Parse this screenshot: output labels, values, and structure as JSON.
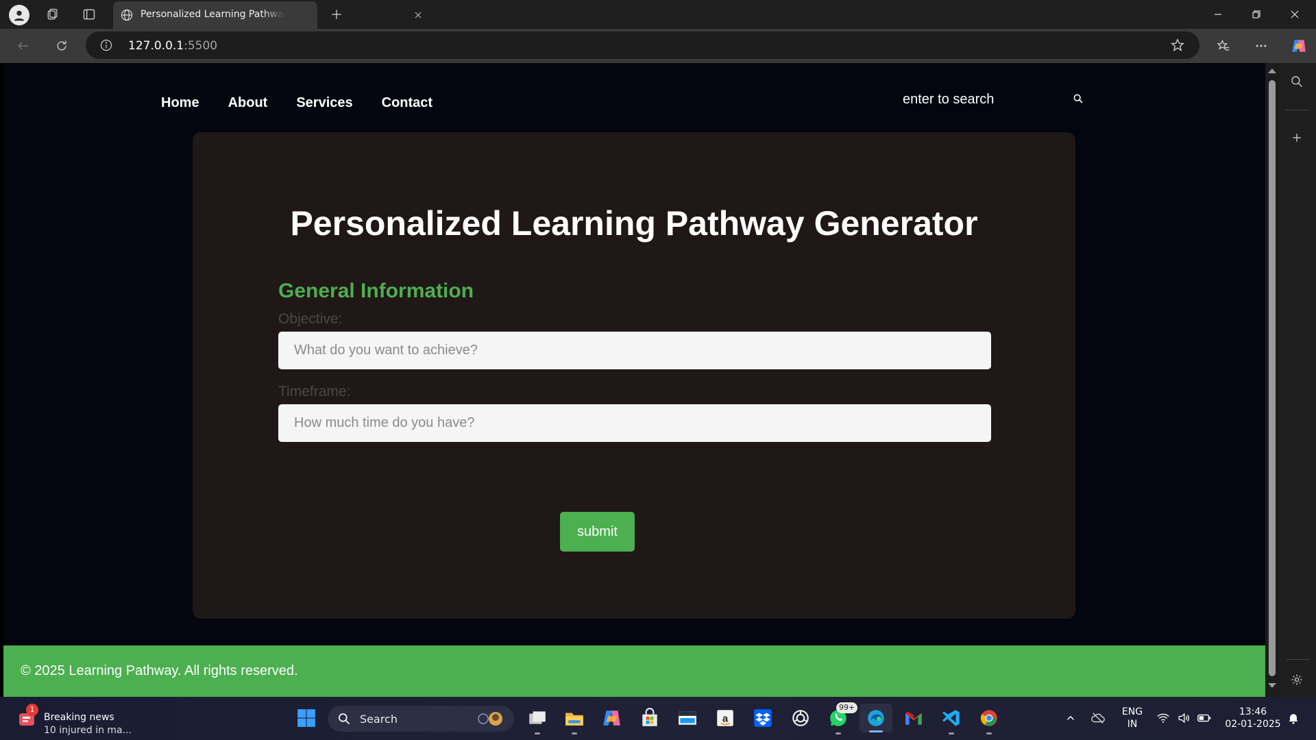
{
  "browser": {
    "tab_title": "Personalized Learning Pathway Generator",
    "url_host": "127.0.0.1",
    "url_port": ":5500"
  },
  "nav": {
    "items": [
      {
        "label": "Home"
      },
      {
        "label": "About"
      },
      {
        "label": "Services"
      },
      {
        "label": "Contact"
      }
    ],
    "search_placeholder": "enter to search"
  },
  "main": {
    "title": "Personalized Learning Pathway Generator",
    "section_heading": "General Information",
    "fields": [
      {
        "label": "Objective:",
        "placeholder": "What do you want to achieve?",
        "value": ""
      },
      {
        "label": "Timeframe:",
        "placeholder": "How much time do you have?",
        "value": ""
      }
    ],
    "submit_label": "submit"
  },
  "footer": {
    "text": "© 2025 Learning Pathway. All rights reserved."
  },
  "colors": {
    "accent": "#4caf50",
    "page_background": "#03060e",
    "card_background": "#201717"
  },
  "taskbar": {
    "news": {
      "badge": "1",
      "title": "Breaking news",
      "subtitle": "10 injured in ma..."
    },
    "search_label": "Search",
    "whatsapp_badge": "99+",
    "language": "ENG",
    "region": "IN",
    "time": "13:46",
    "date": "02-01-2025",
    "pinned_icons": [
      "task-view-icon",
      "file-explorer-icon",
      "copilot-icon",
      "microsoft-store-icon",
      "amazon-prime-icon",
      "amazon-icon",
      "dropbox-icon",
      "chatgpt-icon",
      "whatsapp-icon",
      "edge-icon",
      "gmail-icon",
      "vscode-icon",
      "chrome-icon"
    ]
  }
}
